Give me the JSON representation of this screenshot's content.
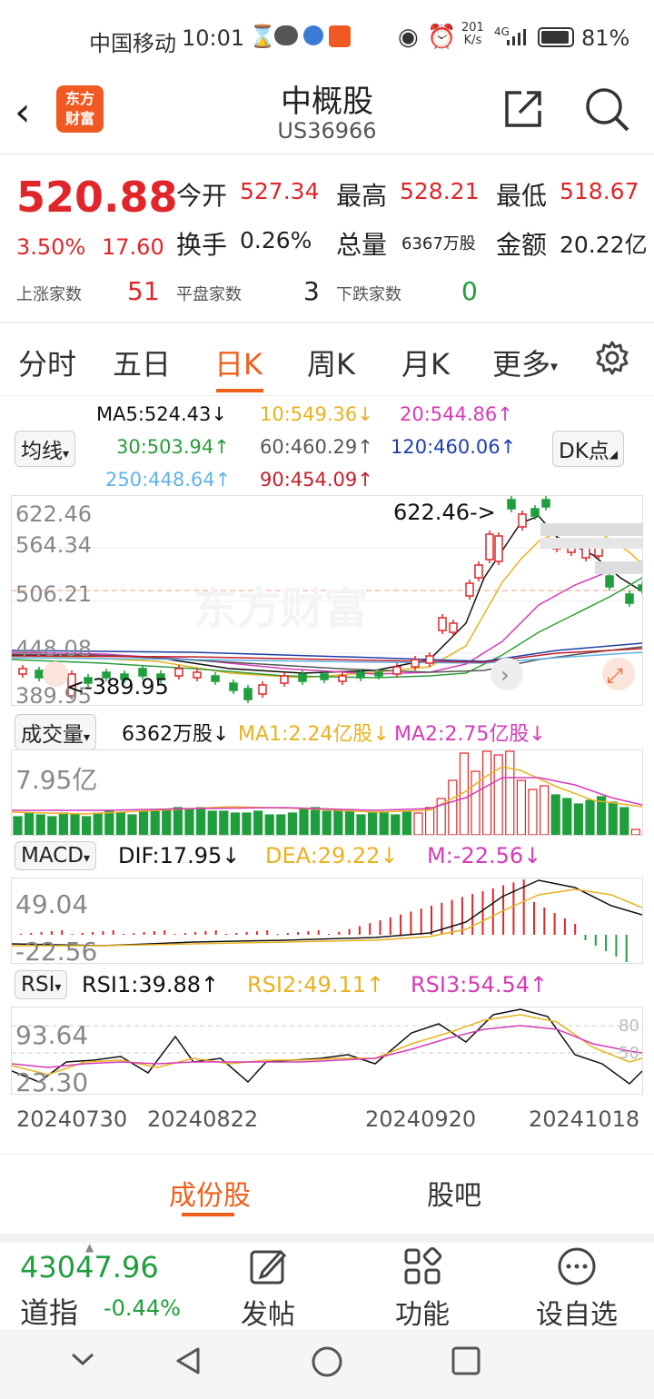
{
  "status": {
    "carrier": "中国移动",
    "time": "10:01",
    "net_speed_top": "201",
    "net_speed_bottom": "K/s",
    "network": "4G",
    "battery": "81%"
  },
  "header": {
    "title": "中概股",
    "code": "US36966",
    "logo_line1": "东方",
    "logo_line2": "财富"
  },
  "quote": {
    "price": "520.88",
    "change_pct": "3.50%",
    "change": "17.60",
    "open_label": "今开",
    "open": "527.34",
    "high_label": "最高",
    "high": "528.21",
    "low_label": "最低",
    "low": "518.67",
    "turnover_label": "换手",
    "turnover": "0.26%",
    "volume_label": "总量",
    "volume": "6367万股",
    "amount_label": "金额",
    "amount": "20.22亿",
    "up_label": "上涨家数",
    "up": "51",
    "flat_label": "平盘家数",
    "flat": "3",
    "down_label": "下跌家数",
    "down": "0"
  },
  "tabs": [
    "分时",
    "五日",
    "日K",
    "周K",
    "月K",
    "更多"
  ],
  "active_tab": "日K",
  "ma": {
    "selector": "均线",
    "ma5": "MA5:524.43↓",
    "ma10": "10:549.36↓",
    "ma20": "20:544.86↑",
    "ma30": "30:503.94↑",
    "ma60": "60:460.29↑",
    "ma120": "120:460.06↑",
    "ma250": "250:448.64↑",
    "ma90": "90:454.09↑",
    "dk": "DK点"
  },
  "kline": {
    "y_labels": [
      "622.46",
      "564.34",
      "506.21",
      "448.08",
      "389.95"
    ],
    "max_marker": "622.46->",
    "min_marker": "<-389.95",
    "watermark": "东方财富"
  },
  "volume": {
    "selector": "成交量",
    "value": "6362万股↓",
    "ma1": "MA1:2.24亿股↓",
    "ma2": "MA2:2.75亿股↓",
    "y_label": "7.95亿"
  },
  "macd": {
    "selector": "MACD",
    "dif": "DIF:17.95↓",
    "dea": "DEA:29.22↓",
    "m": "M:-22.56↓",
    "y_top": "49.04",
    "y_bottom": "-22.56"
  },
  "rsi": {
    "selector": "RSI",
    "rsi1": "RSI1:39.88↑",
    "rsi2": "RSI2:49.11↑",
    "rsi3": "RSI3:54.54↑",
    "y_top": "93.64",
    "y_bottom": "23.30",
    "ref_high": "80",
    "ref_mid": "50"
  },
  "dates": [
    "20240730",
    "20240822",
    "20240920",
    "20241018"
  ],
  "bottom_tabs": [
    "成份股",
    "股吧"
  ],
  "footer": {
    "index_value": "43047.96",
    "index_name": "道指",
    "index_change": "-0.44%",
    "post": "发帖",
    "func": "功能",
    "add_fav": "设自选"
  },
  "colors": {
    "up": "#e0262a",
    "down": "#1e9e3c",
    "accent": "#f0601d",
    "ma5": "#111111",
    "ma10": "#e8b21f",
    "ma20": "#d63bb8",
    "ma30": "#2a9d3a",
    "ma60": "#555555",
    "ma120": "#1f3fa8",
    "ma250": "#5fb4e6",
    "ma90": "#c3202a"
  }
}
